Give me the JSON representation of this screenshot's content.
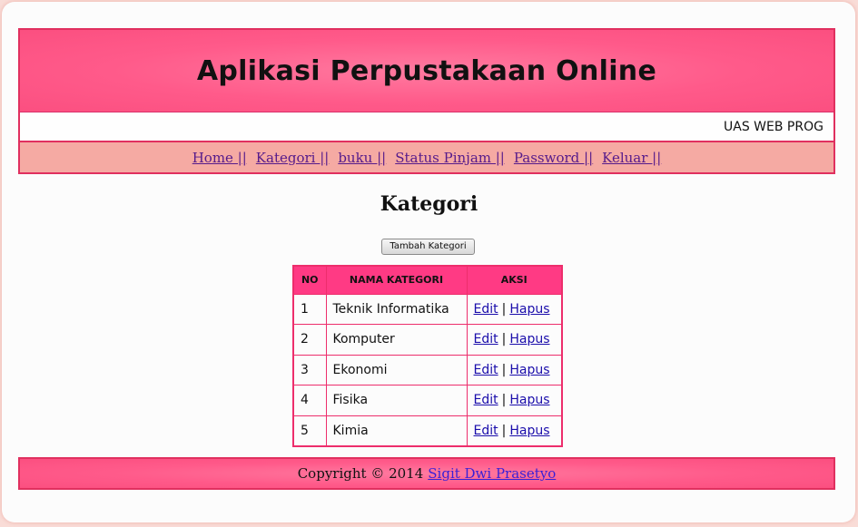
{
  "header": {
    "title": "Aplikasi Perpustakaan Online",
    "marquee": "UAS WEB PROG"
  },
  "nav": {
    "items": [
      {
        "label": "Home ||"
      },
      {
        "label": "Kategori ||"
      },
      {
        "label": "buku ||"
      },
      {
        "label": "Status Pinjam ||"
      },
      {
        "label": "Password ||"
      },
      {
        "label": "Keluar ||"
      }
    ]
  },
  "main": {
    "title": "Kategori",
    "add_button_label": "Tambah Kategori",
    "table": {
      "headers": [
        "NO",
        "NAMA KATEGORI",
        "AKSI"
      ],
      "edit_label": "Edit",
      "separator": "|",
      "delete_label": "Hapus",
      "rows": [
        {
          "no": "1",
          "nama": "Teknik Informatika"
        },
        {
          "no": "2",
          "nama": "Komputer"
        },
        {
          "no": "3",
          "nama": "Ekonomi"
        },
        {
          "no": "4",
          "nama": "Fisika"
        },
        {
          "no": "5",
          "nama": "Kimia"
        }
      ]
    }
  },
  "footer": {
    "copyright": "Copyright © 2014",
    "author": "Sigit Dwi Prasetyo"
  },
  "colors": {
    "header_pink": "#ff5a8a",
    "nav_salmon": "#f5aaa3",
    "table_header": "#ff3a84",
    "border": "#e0305f",
    "link_visited": "#551a8b",
    "link": "#1a0dab"
  }
}
